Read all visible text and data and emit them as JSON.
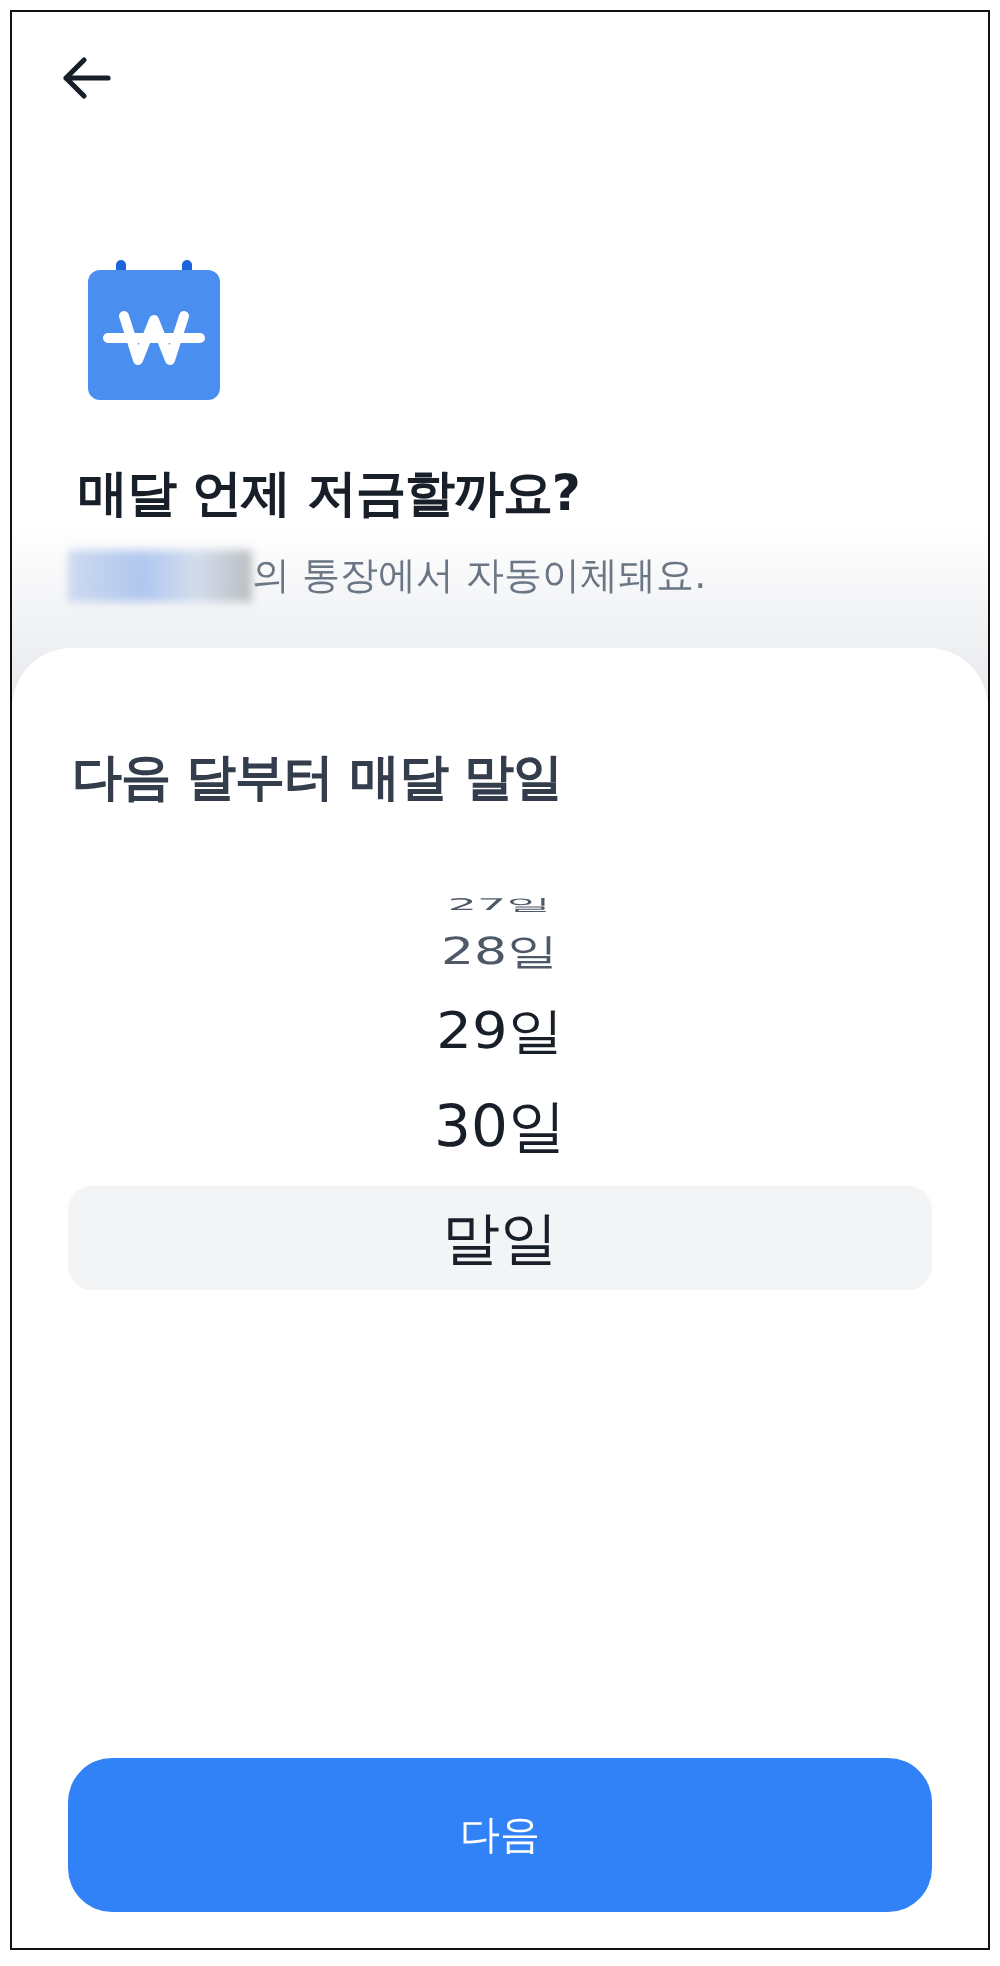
{
  "title": "매달 언제 저금할까요?",
  "subtitle": "의 통장에서 자동이체돼요.",
  "sheet": {
    "title": "다음 달부터 매달 말일",
    "picker": [
      {
        "label": "27일",
        "selected": false
      },
      {
        "label": "28일",
        "selected": false
      },
      {
        "label": "29일",
        "selected": false
      },
      {
        "label": "30일",
        "selected": false
      },
      {
        "label": "말일",
        "selected": true
      }
    ]
  },
  "button": "다음"
}
